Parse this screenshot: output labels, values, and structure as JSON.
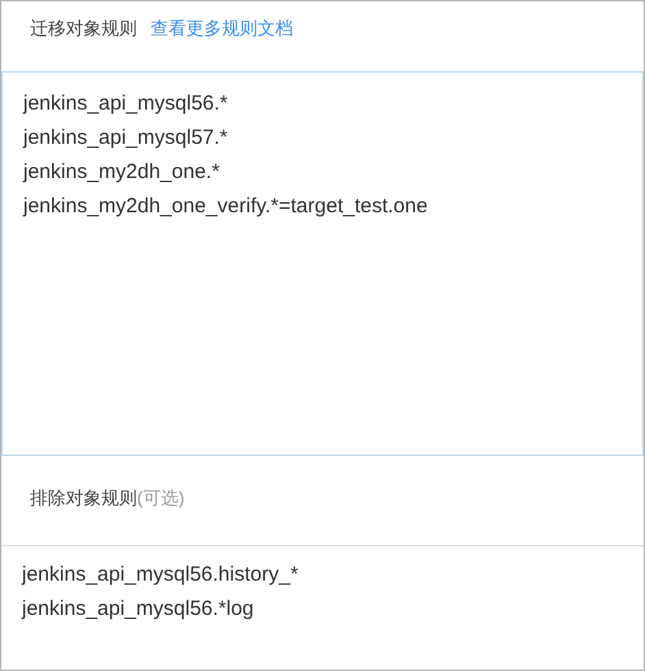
{
  "migrate_rules": {
    "label": "迁移对象规则",
    "link": "查看更多规则文档",
    "lines": [
      "jenkins_api_mysql56.*",
      "jenkins_api_mysql57.*",
      "jenkins_my2dh_one.*",
      "jenkins_my2dh_one_verify.*=target_test.one"
    ]
  },
  "exclude_rules": {
    "label": "排除对象规则",
    "hint": "(可选)",
    "lines": [
      "jenkins_api_mysql56.history_*",
      "jenkins_api_mysql56.*log"
    ]
  }
}
